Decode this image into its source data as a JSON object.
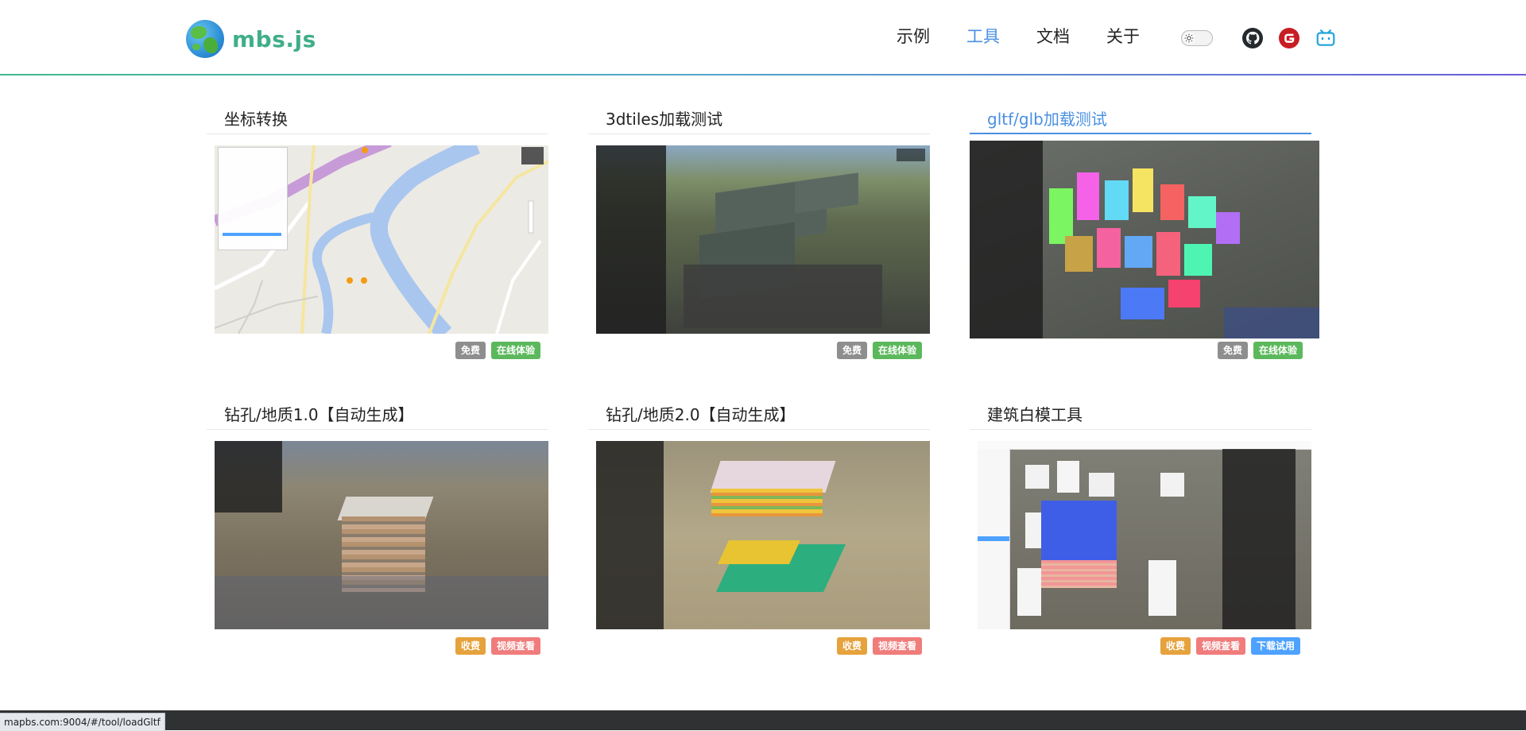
{
  "brand": {
    "name": "mbs.js"
  },
  "nav": {
    "items": [
      "示例",
      "工具",
      "文档",
      "关于"
    ],
    "active": "工具"
  },
  "colors": {
    "accent": "#4a90e2",
    "brand": "#3fae8a",
    "free": "#8e8e8e",
    "try_online": "#5cb85c",
    "paid": "#e6a23c",
    "video": "#f07c7c",
    "download": "#4ea2ff"
  },
  "icons": {
    "theme_toggle": "sun-icon",
    "github": "github-icon",
    "gitee": "gitee-icon",
    "bilibili": "bilibili-icon"
  },
  "cards": [
    {
      "title": "坐标转换",
      "buttons": [
        "免费",
        "在线体验"
      ]
    },
    {
      "title": "3dtiles加载测试",
      "buttons": [
        "免费",
        "在线体验"
      ]
    },
    {
      "title": "gltf/glb加载测试",
      "buttons": [
        "免费",
        "在线体验"
      ]
    },
    {
      "title": "钻孔/地质1.0【自动生成】",
      "buttons": [
        "收费",
        "视频查看"
      ]
    },
    {
      "title": "钻孔/地质2.0【自动生成】",
      "buttons": [
        "收费",
        "视频查看"
      ]
    },
    {
      "title": "建筑白模工具",
      "buttons": [
        "收费",
        "视频查看",
        "下载试用"
      ]
    }
  ],
  "status_bar": {
    "url": "mapbs.com:9004/#/tool/loadGltf"
  }
}
